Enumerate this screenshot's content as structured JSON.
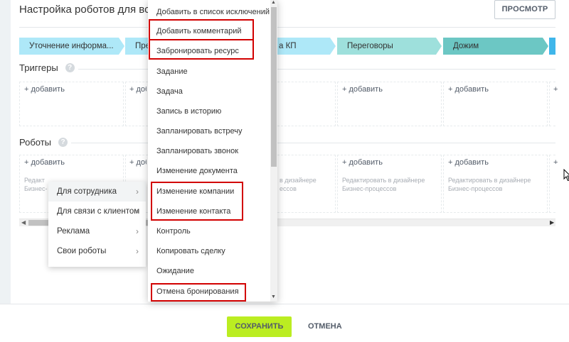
{
  "header": {
    "title": "Настройка роботов для всех с",
    "preview_label": "ПРОСМОТР"
  },
  "stages": [
    {
      "label": "Уточнение информа...",
      "color": "#aee8f8"
    },
    {
      "label": "Пре",
      "color": "#aee8f8"
    },
    {
      "label": "а КП",
      "color": "#aee8f8"
    },
    {
      "label": "Переговоры",
      "color": "#9ee0dc"
    },
    {
      "label": "Дожим",
      "color": "#6cc7c4"
    },
    {
      "label": "",
      "color": "#3fb6ea"
    }
  ],
  "triggers": {
    "title": "Триггеры",
    "help": "?",
    "add_label": "+ добавить"
  },
  "robots": {
    "title": "Роботы",
    "help": "?",
    "add_label": "+ добавить",
    "hint_line1": "Редактировать в дизайнере",
    "hint_line2": "Бизнес-процессов",
    "hint_line1_partial": "Редакт",
    "hint_line2_partial": "Бизнес-",
    "hint_line1_mid": "в дизайнере",
    "hint_line2_mid": "ессов"
  },
  "submenu": {
    "items": [
      {
        "label": "Для сотрудника",
        "arrow": "›"
      },
      {
        "label": "Для связи с клиентом",
        "arrow": "›"
      },
      {
        "label": "Реклама",
        "arrow": "›"
      },
      {
        "label": "Свои роботы",
        "arrow": "›"
      }
    ]
  },
  "dropdown": {
    "items": [
      "Добавить в список исключений",
      "Добавить комментарий",
      "Забронировать ресурс",
      "Задание",
      "Задача",
      "Запись в историю",
      "Запланировать встречу",
      "Запланировать звонок",
      "Изменение документа",
      "Изменение компании",
      "Изменение контакта",
      "Контроль",
      "Копировать сделку",
      "Ожидание",
      "Отмена бронирования"
    ]
  },
  "footer": {
    "save_label": "СОХРАНИТЬ",
    "cancel_label": "ОТМЕНА"
  },
  "scroll": {
    "left_arrow": "◀",
    "right_arrow": "▶",
    "up_arrow": "▲",
    "down_arrow": "▼"
  },
  "colors": {
    "accent_save": "#bbed21",
    "highlight": "#d20000"
  }
}
